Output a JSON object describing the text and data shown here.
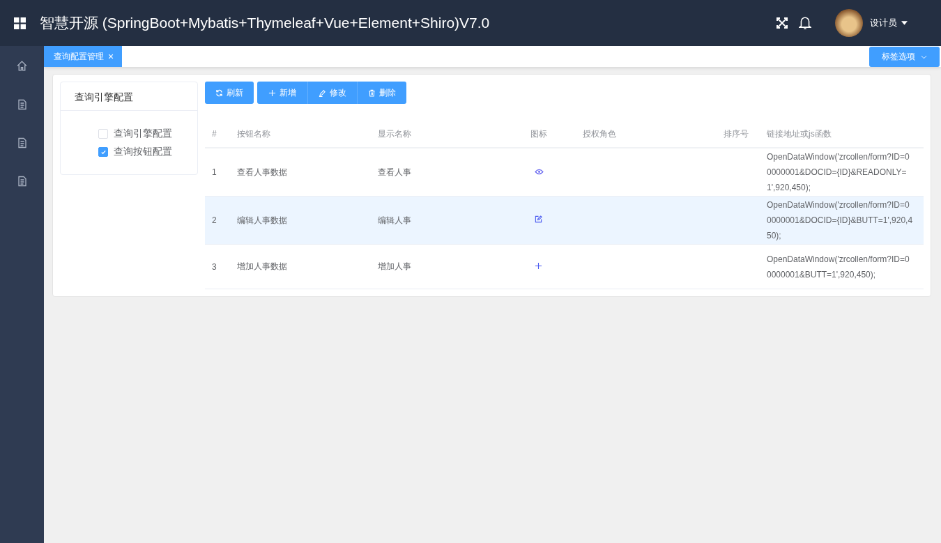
{
  "header": {
    "title": "智慧开源 (SpringBoot+Mybatis+Thymeleaf+Vue+Element+Shiro)V7.0",
    "user": "设计员"
  },
  "sidebar": {
    "items": [
      {
        "kind": "home"
      },
      {
        "kind": "doc"
      },
      {
        "kind": "doc"
      },
      {
        "kind": "doc"
      }
    ]
  },
  "tabs": [
    {
      "label": "查询配置管理",
      "close": "×",
      "selected": true
    }
  ],
  "tab_options": "标签选项",
  "tree": {
    "title": "查询引擎配置",
    "items": [
      {
        "label": "查询引擎配置",
        "checked": false
      },
      {
        "label": "查询按钮配置",
        "checked": true
      }
    ]
  },
  "toolbar": [
    {
      "kind": "refresh",
      "label": "刷新"
    },
    {
      "kind": "add",
      "label": "新增"
    },
    {
      "kind": "edit",
      "label": "修改"
    },
    {
      "kind": "delete",
      "label": "删除"
    }
  ],
  "table": {
    "columns": [
      "#",
      "按钮名称",
      "显示名称",
      "图标",
      "授权角色",
      "排序号",
      "链接地址或js函数"
    ],
    "rows": [
      {
        "index": "1",
        "name": "查看人事数据",
        "display": "查看人事",
        "kind": "view",
        "link": "OpenDataWindow('zrcollen/form?ID=00000001&DOCID={ID}&READONLY=1',920,450);",
        "selected": false
      },
      {
        "index": "2",
        "name": "编辑人事数据",
        "display": "编辑人事",
        "kind": "edit",
        "link": "OpenDataWindow('zrcollen/form?ID=00000001&DOCID={ID}&BUTT=1',920,450);",
        "selected": true
      },
      {
        "index": "3",
        "name": "增加人事数据",
        "display": "增加人事",
        "kind": "add",
        "link": "OpenDataWindow('zrcollen/form?ID=00000001&BUTT=1',920,450);",
        "selected": false
      }
    ]
  }
}
